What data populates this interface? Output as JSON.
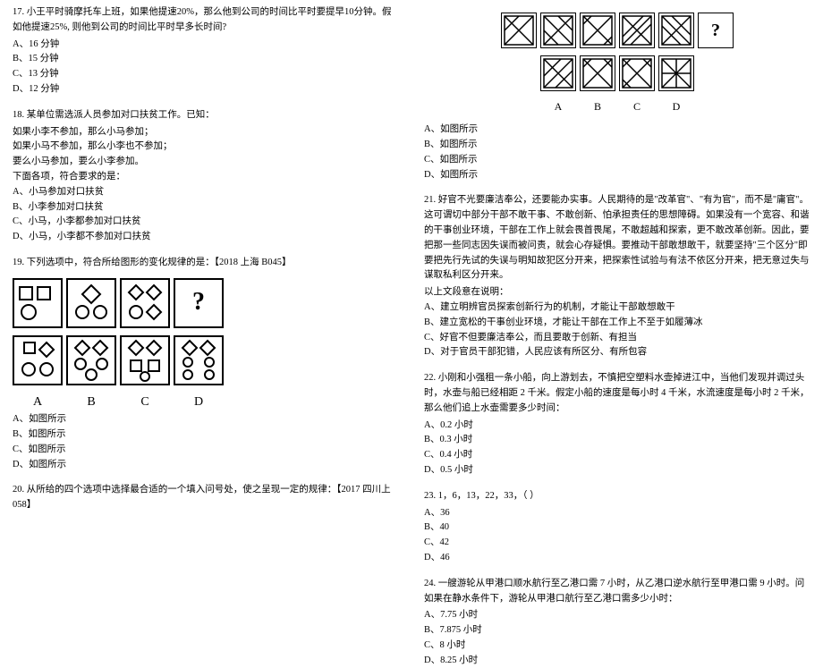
{
  "left": {
    "q17": {
      "text": "17. 小王平时骑摩托车上班，如果他提速20%，那么他到公司的时间比平时要提早10分钟。假如他提速25%, 则他到公司的时间比平时早多长时间?",
      "a": "A、16 分钟",
      "b": "B、15 分钟",
      "c": "C、13 分钟",
      "d": "D、12 分钟"
    },
    "q18": {
      "text": "18. 某单位需选派人员参加对口扶贫工作。已知：",
      "l1": "如果小李不参加，那么小马参加；",
      "l2": "如果小马不参加，那么小李也不参加；",
      "l3": "要么小马参加，要么小李参加。",
      "l4": "下面各项，符合要求的是：",
      "a": "A、小马参加对口扶贫",
      "b": "B、小李参加对口扶贫",
      "c": "C、小马，小李都参加对口扶贫",
      "d": "D、小马，小李都不参加对口扶贫"
    },
    "q19": {
      "text": "19. 下列选项中，符合所给图形的变化规律的是：【2018 上海 B045】",
      "a": "A、如图所示",
      "b": "B、如图所示",
      "c": "C、如图所示",
      "d": "D、如图所示",
      "labA": "A",
      "labB": "B",
      "labC": "C",
      "labD": "D"
    },
    "q20": {
      "text": "20. 从所给的四个选项中选择最合适的一个填入问号处，使之呈现一定的规律：【2017 四川上 058】"
    }
  },
  "right": {
    "q20opts": {
      "a": "A、如图所示",
      "b": "B、如图所示",
      "c": "C、如图所示",
      "d": "D、如图所示",
      "labA": "A",
      "labB": "B",
      "labC": "C",
      "labD": "D"
    },
    "q21": {
      "text": "21. 好官不光要廉洁奉公，还要能办实事。人民期待的是\"改革官\"、\"有为官\"，而不是\"庸官\"。这可谓切中部分干部不敢干事、不敢创新、怕承担责任的思想障碍。如果没有一个宽容、和谐的干事创业环境，干部在工作上就会畏首畏尾，不敢超越和探索，更不敢改革创新。因此，要把那一些同志因失误而被问责，就会心存疑惧。要推动干部敢想敢干，就要坚持\"三个区分\"即要把先行先试的失误与明知故犯区分开来，把探索性试验与有法不依区分开来，把无意过失与谋取私利区分开来。",
      "l1": "以上文段意在说明：",
      "a": "A、建立明辨官员探索创新行为的机制，才能让干部敢想敢干",
      "b": "B、建立宽松的干事创业环境，才能让干部在工作上不至于如履薄冰",
      "c": "C、好官不但要廉洁奉公，而且要敢于创新、有担当",
      "d": "D、对于官员干部犯错，人民应该有所区分、有所包容"
    },
    "q22": {
      "text": "22. 小刚和小强租一条小船，向上游划去，不慎把空塑料水壶掉进江中，当他们发现并调过头时，水壶与船已经相距 2 千米。假定小船的速度是每小时 4 千米，水流速度是每小时 2 千米，那么他们追上水壶需要多少时间：",
      "a": "A、0.2 小时",
      "b": "B、0.3 小时",
      "c": "C、0.4 小时",
      "d": "D、0.5 小时"
    },
    "q23": {
      "text": "23. 1，6，13，22，33，（    ）",
      "a": "A、36",
      "b": "B、40",
      "c": "C、42",
      "d": "D、46"
    },
    "q24": {
      "text": "24. 一艘游轮从甲港口顺水航行至乙港口需 7 小时，从乙港口逆水航行至甲港口需 9 小时。问如果在静水条件下，游轮从甲港口航行至乙港口需多少小时：",
      "a": "A、7.75 小时",
      "b": "B、7.875 小时",
      "c": "C、8 小时",
      "d": "D、8.25 小时"
    }
  }
}
